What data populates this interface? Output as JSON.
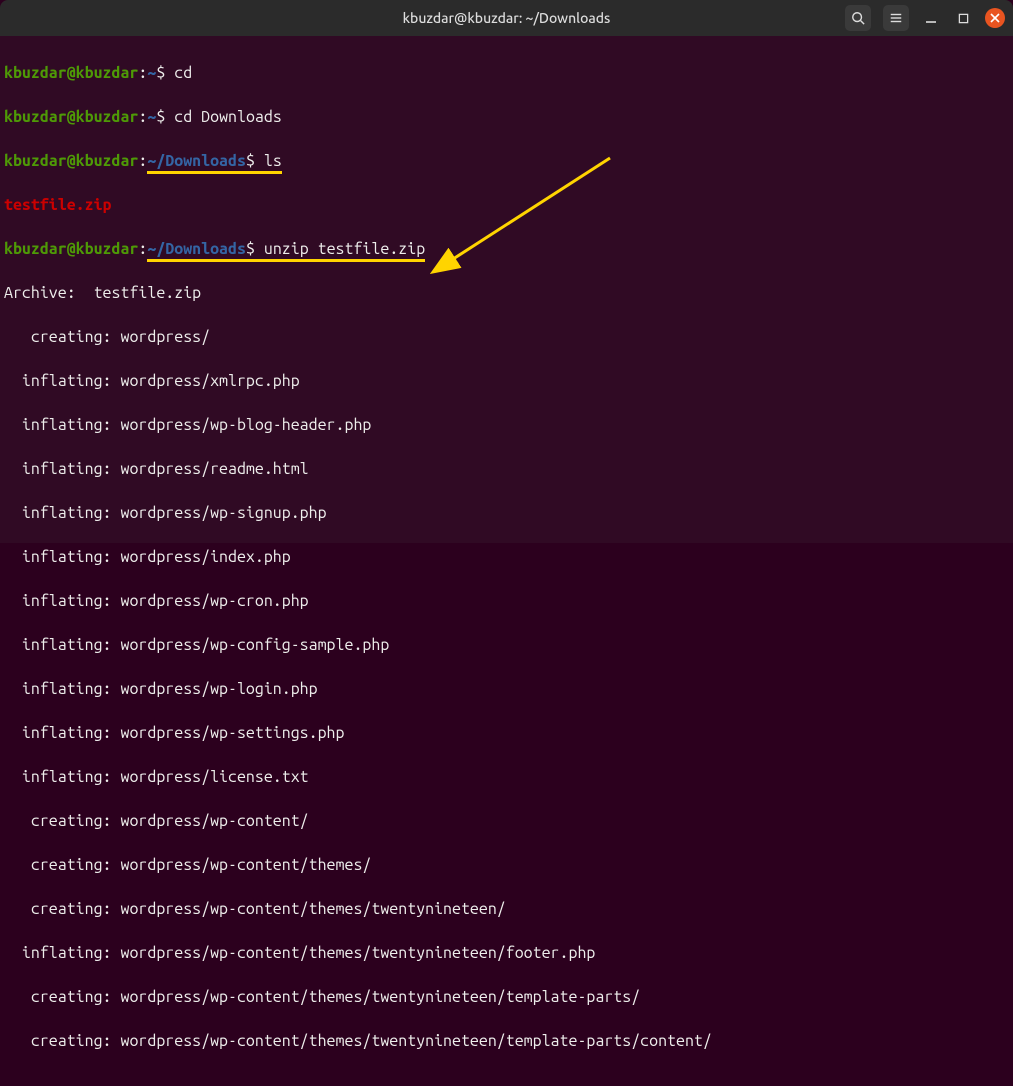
{
  "window": {
    "title": "kbuzdar@kbuzdar: ~/Downloads"
  },
  "prompt": {
    "userhost": "kbuzdar@kbuzdar",
    "home_path": "~",
    "downloads_path": "~/Downloads",
    "sep": ":",
    "dollar": "$"
  },
  "commands": {
    "cd": "cd",
    "cd_downloads": "cd Downloads",
    "ls": "ls",
    "unzip": "unzip testfile.zip"
  },
  "ls_output": {
    "file": "testfile.zip"
  },
  "unzip_output": {
    "archive_line": "Archive:  testfile.zip",
    "entries": [
      "   creating: wordpress/",
      "  inflating: wordpress/xmlrpc.php",
      "  inflating: wordpress/wp-blog-header.php",
      "  inflating: wordpress/readme.html",
      "  inflating: wordpress/wp-signup.php",
      "  inflating: wordpress/index.php",
      "  inflating: wordpress/wp-cron.php",
      "  inflating: wordpress/wp-config-sample.php",
      "  inflating: wordpress/wp-login.php",
      "  inflating: wordpress/wp-settings.php",
      "  inflating: wordpress/license.txt",
      "   creating: wordpress/wp-content/",
      "   creating: wordpress/wp-content/themes/",
      "   creating: wordpress/wp-content/themes/twentynineteen/",
      "  inflating: wordpress/wp-content/themes/twentynineteen/footer.php",
      "   creating: wordpress/wp-content/themes/twentynineteen/template-parts/",
      "   creating: wordpress/wp-content/themes/twentynineteen/template-parts/content/"
    ]
  }
}
